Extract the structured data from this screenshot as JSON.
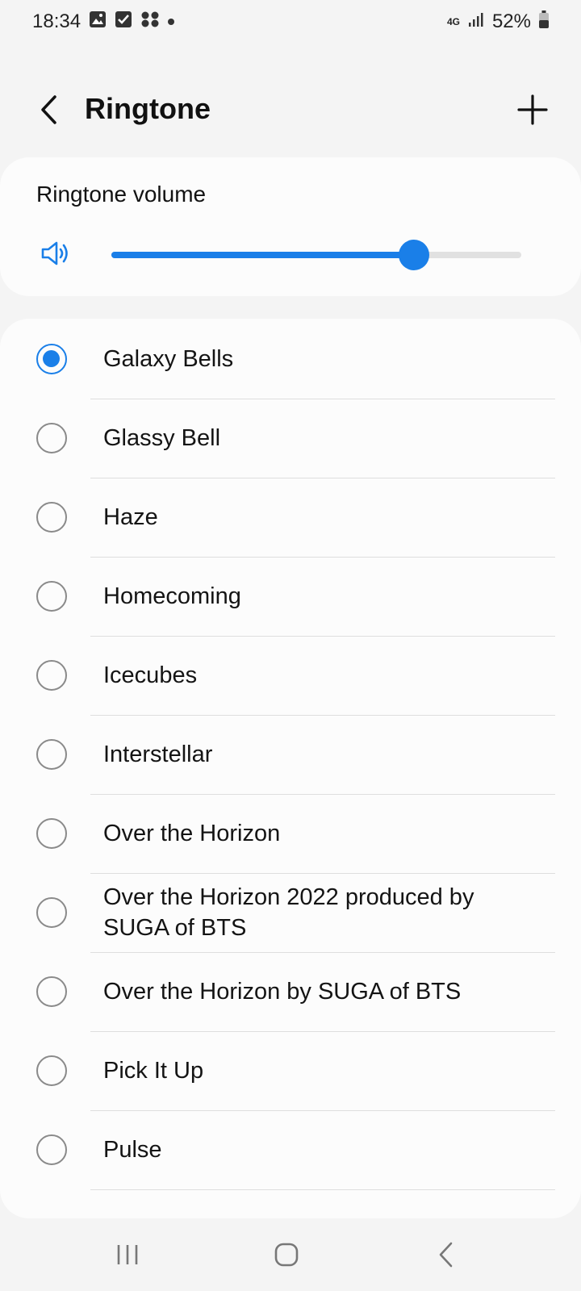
{
  "status_bar": {
    "time": "18:34",
    "network": "4G",
    "battery": "52%",
    "icons": [
      "gallery-icon",
      "checkbox-icon",
      "apps-icon",
      "notification-dot-icon",
      "signal-icon",
      "battery-icon"
    ]
  },
  "header": {
    "title": "Ringtone",
    "back_icon": "chevron-left-icon",
    "add_icon": "plus-icon"
  },
  "volume": {
    "label": "Ringtone volume",
    "icon": "speaker-icon",
    "level_fraction": 0.738,
    "accent_color": "#1a7fe8"
  },
  "ringtones": {
    "selected_index": 0,
    "items": [
      {
        "label": "Galaxy Bells"
      },
      {
        "label": "Glassy Bell"
      },
      {
        "label": "Haze"
      },
      {
        "label": "Homecoming"
      },
      {
        "label": "Icecubes"
      },
      {
        "label": "Interstellar"
      },
      {
        "label": "Over the Horizon"
      },
      {
        "label": "Over the Horizon 2022 produced by SUGA of BTS"
      },
      {
        "label": "Over the Horizon by SUGA of BTS"
      },
      {
        "label": "Pick It Up"
      },
      {
        "label": "Pulse"
      }
    ]
  },
  "nav_bar": {
    "icons": [
      "recents-icon",
      "home-icon",
      "back-icon"
    ]
  }
}
